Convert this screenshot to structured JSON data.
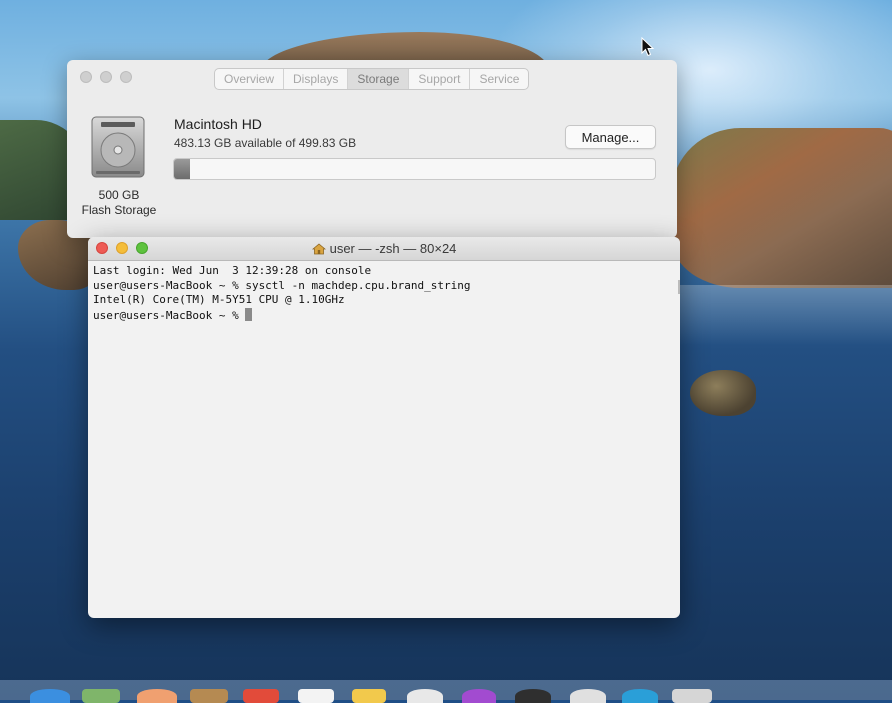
{
  "sysinfo": {
    "tabs": [
      {
        "label": "Overview",
        "active": false
      },
      {
        "label": "Displays",
        "active": false
      },
      {
        "label": "Storage",
        "active": true
      },
      {
        "label": "Support",
        "active": false
      },
      {
        "label": "Service",
        "active": false
      }
    ],
    "disk": {
      "name": "Macintosh HD",
      "available_text": "483.13 GB available of 499.83 GB",
      "capacity": "500 GB",
      "type": "Flash Storage",
      "used_fraction": 0.033
    },
    "manage_label": "Manage..."
  },
  "terminal": {
    "title": "user — -zsh — 80×24",
    "lines": [
      "Last login: Wed Jun  3 12:39:28 on console",
      "user@users-MacBook ~ % sysctl -n machdep.cpu.brand_string",
      "Intel(R) Core(TM) M-5Y51 CPU @ 1.10GHz",
      "user@users-MacBook ~ % "
    ]
  },
  "colors": {
    "close": "#ee5b55",
    "minimize": "#f4bd3a",
    "zoom": "#5ec23e"
  },
  "icons": {
    "disk": "hard-drive-icon",
    "home": "home-icon",
    "pointer": "mouse-pointer-icon"
  }
}
